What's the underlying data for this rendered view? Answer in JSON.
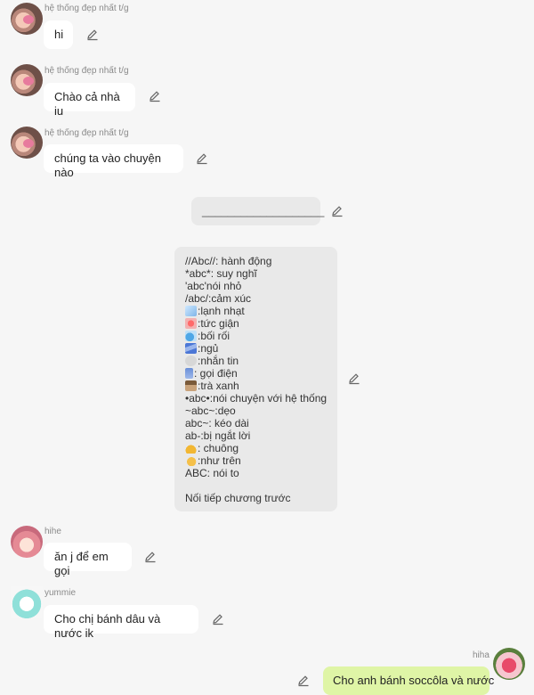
{
  "messages": [
    {
      "sender": "hệ thống đẹp nhất t/g",
      "text": "hi"
    },
    {
      "sender": "hệ thống đẹp nhất t/g",
      "text": "Chào cả nhà iu"
    },
    {
      "sender": "hệ thống đẹp nhất t/g",
      "text": "chúng ta vào chuyện nào"
    },
    {
      "text": "___________________"
    },
    {
      "lines": [
        "//Abc//: hành động",
        "*abc*: suy nghĩ",
        "'abc'nói nhỏ",
        "/abc/:cảm xúc",
        ":lạnh nhạt",
        ":tức giận",
        ":bối rối",
        ":ngủ",
        ":nhắn tin",
        ": gọi điện",
        ":trà xanh",
        "•abc•:nói chuyện với hệ thống",
        "~abc~:dẹo",
        "abc~: kéo dài",
        "ab-:bị ngắt lời",
        ": chuông",
        ":như trên",
        "ABC: nói to",
        "",
        "Nối tiếp chương trước"
      ]
    },
    {
      "sender": "hihe",
      "text": "ăn j để em gọi"
    },
    {
      "sender": "yummie",
      "text": "Cho chị bánh dâu và nước ik"
    },
    {
      "sender": "hiha",
      "text": "Cho anh bánh soccôla và nước"
    }
  ],
  "icons": {
    "cube": "ice-cube-icon",
    "anger": "anger-icon",
    "sweat": "sweat-icon",
    "zzz": "sleep-icon",
    "speech": "speech-bubble-icon",
    "phone": "phone-icon",
    "tea": "tea-icon",
    "bell": "bell-icon",
    "point": "pointing-hand-icon"
  },
  "colors": {
    "background": "#f6f6f6",
    "bubble": "#ffffff",
    "system_bubble": "#e9e9e9",
    "own_bubble": "#dff5a6"
  }
}
